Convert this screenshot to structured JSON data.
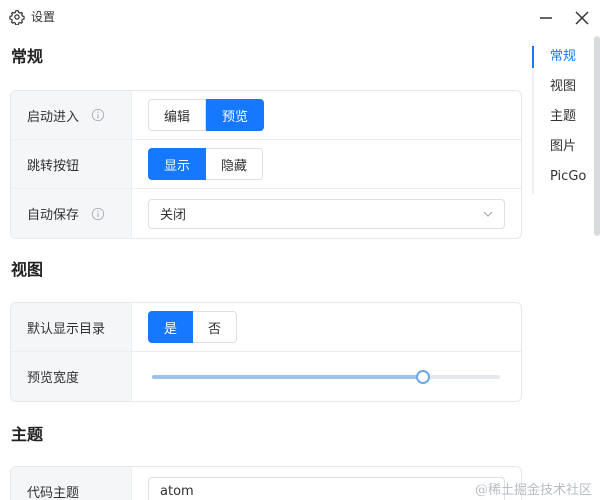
{
  "window": {
    "title": "设置",
    "icon": "gear-icon",
    "minimize_icon": "minimize-icon",
    "close_icon": "close-icon"
  },
  "sections": {
    "general": {
      "title": "常规",
      "startup": {
        "label": "启动进入",
        "info_icon": "info-icon",
        "options": [
          "编辑",
          "预览"
        ],
        "selected": "预览"
      },
      "jump_button": {
        "label": "跳转按钮",
        "options": [
          "显示",
          "隐藏"
        ],
        "selected": "显示"
      },
      "auto_save": {
        "label": "自动保存",
        "info_icon": "info-icon",
        "value": "关闭",
        "dropdown_icon": "chevron-down-icon"
      }
    },
    "view": {
      "title": "视图",
      "show_toc": {
        "label": "默认显示目录",
        "options": [
          "是",
          "否"
        ],
        "selected": "是"
      },
      "preview_width": {
        "label": "预览宽度",
        "fraction": 0.78
      }
    },
    "theme": {
      "title": "主题",
      "code_theme": {
        "label": "代码主题",
        "value": "atom"
      }
    }
  },
  "nav": {
    "items": [
      "常规",
      "视图",
      "主题",
      "图片",
      "PicGo"
    ],
    "active": "常规"
  },
  "watermark": "@稀土掘金技术社区",
  "colors": {
    "accent": "#1677ff",
    "label_bg": "#f5f6f8",
    "border": "#e6e8ec",
    "slider_fill": "#9dc3e8"
  }
}
